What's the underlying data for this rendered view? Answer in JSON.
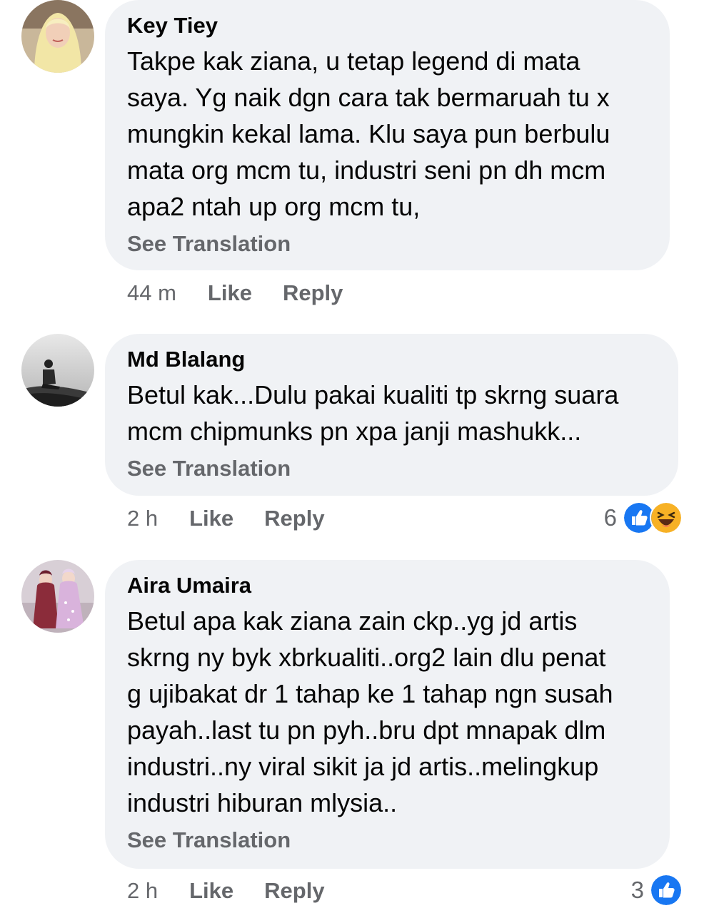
{
  "comments": [
    {
      "author": "Key Tiey",
      "text": "Takpe kak ziana, u tetap legend di mata\nsaya. Yg naik dgn cara tak bermaruah tu x\nmungkin kekal lama. Klu saya pun berbulu\nmata org mcm tu, industri seni pn dh mcm\napa2 ntah up org mcm tu,",
      "see_translation": "See Translation",
      "time": "44 m",
      "like": "Like",
      "reply": "Reply",
      "reaction_count": ""
    },
    {
      "author": "Md Blalang",
      "text": "Betul kak...Dulu pakai kualiti tp skrng suara\nmcm chipmunks pn xpa janji mashukk...",
      "see_translation": "See Translation",
      "time": "2 h",
      "like": "Like",
      "reply": "Reply",
      "reaction_count": "6",
      "reactions": [
        "like-icon",
        "haha-icon"
      ]
    },
    {
      "author": "Aira Umaira",
      "text": "Betul apa kak ziana zain ckp..yg jd artis\nskrng ny byk xbrkualiti..org2 lain dlu penat\ng ujibakat dr 1 tahap ke 1 tahap ngn susah\npayah..last tu pn pyh..bru dpt mnapak dlm\nindustri..ny viral sikit ja jd artis..melingkup\nindustri hiburan mlysia..",
      "see_translation": "See Translation",
      "time": "2 h",
      "like": "Like",
      "reply": "Reply",
      "reaction_count": "3",
      "reactions": [
        "like-icon"
      ]
    }
  ],
  "colors": {
    "bubble": "#f0f2f5",
    "meta_text": "#65676b",
    "like_blue": "#1877f2",
    "haha_yellow": "#f7b125"
  }
}
